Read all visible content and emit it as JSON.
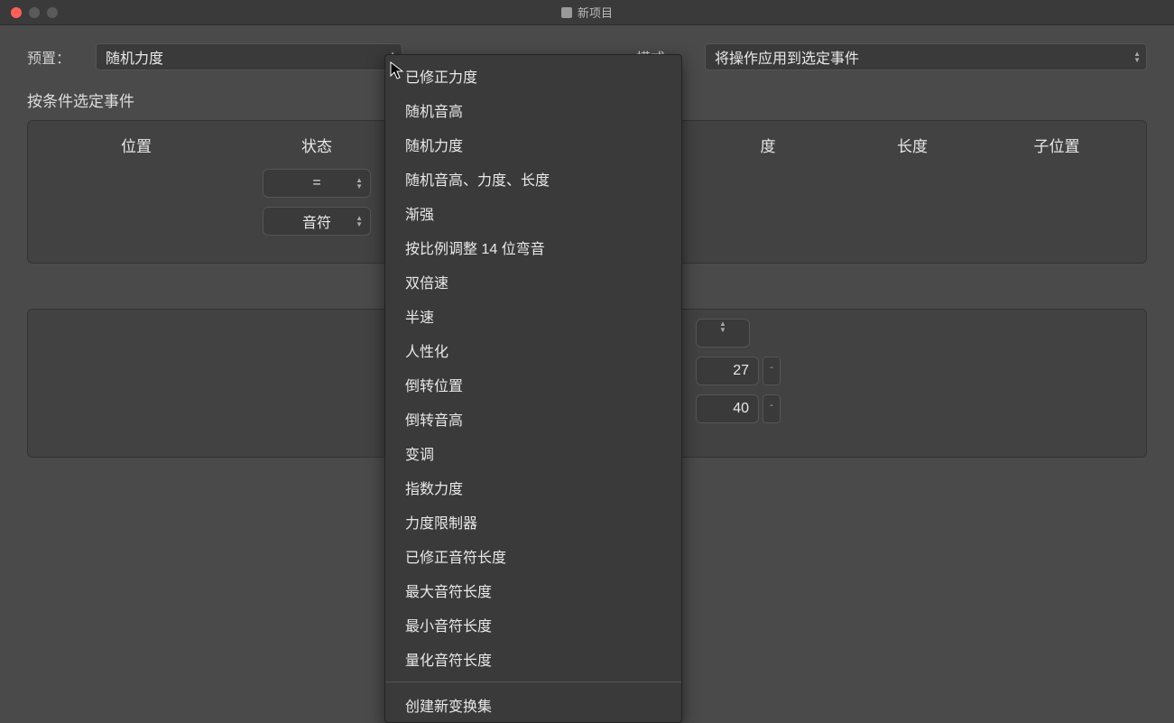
{
  "window": {
    "title": "新项目"
  },
  "preset": {
    "label": "预置：",
    "value": "随机力度"
  },
  "mode": {
    "label": "模式：",
    "value": "将操作应用到选定事件"
  },
  "conditions_section_label": "按条件选定事件",
  "columns": {
    "position": "位置",
    "status": "状态",
    "du": "度",
    "length": "长度",
    "subposition": "子位置"
  },
  "status_controls": {
    "operator": "=",
    "type": "音符"
  },
  "popup_items": [
    "已修正力度",
    "随机音高",
    "随机力度",
    "随机音高、力度、长度",
    "渐强",
    "按比例调整 14 位弯音",
    "双倍速",
    "半速",
    "人性化",
    "倒转位置",
    "倒转音高",
    "变调",
    "指数力度",
    "力度限制器",
    "已修正音符长度",
    "最大音符长度",
    "最小音符长度",
    "量化音符长度"
  ],
  "popup_footer": "创建新变换集",
  "panel2": {
    "value1": "27",
    "value2": "40"
  }
}
